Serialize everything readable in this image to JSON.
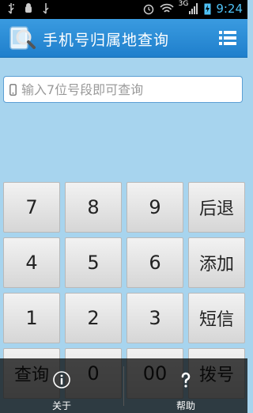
{
  "status_bar": {
    "network": "3G",
    "time": "9:24"
  },
  "app_bar": {
    "title": "手机号归属地查询",
    "menu_icon": "list-menu-icon"
  },
  "search": {
    "placeholder": "输入7位号段即可查询",
    "value": ""
  },
  "keypad": {
    "rows": [
      [
        "7",
        "8",
        "9",
        "后退"
      ],
      [
        "4",
        "5",
        "6",
        "添加"
      ],
      [
        "1",
        "2",
        "3",
        "短信"
      ],
      [
        "查询",
        "0",
        "00",
        "拨号"
      ]
    ]
  },
  "bottom_bar": {
    "about": {
      "label": "关于",
      "icon": "info-icon"
    },
    "help": {
      "label": "帮助",
      "icon": "question-icon"
    }
  },
  "colors": {
    "background": "#a7d4ee",
    "app_bar": "#2a8cd8",
    "status_time": "#4fc3f7"
  }
}
